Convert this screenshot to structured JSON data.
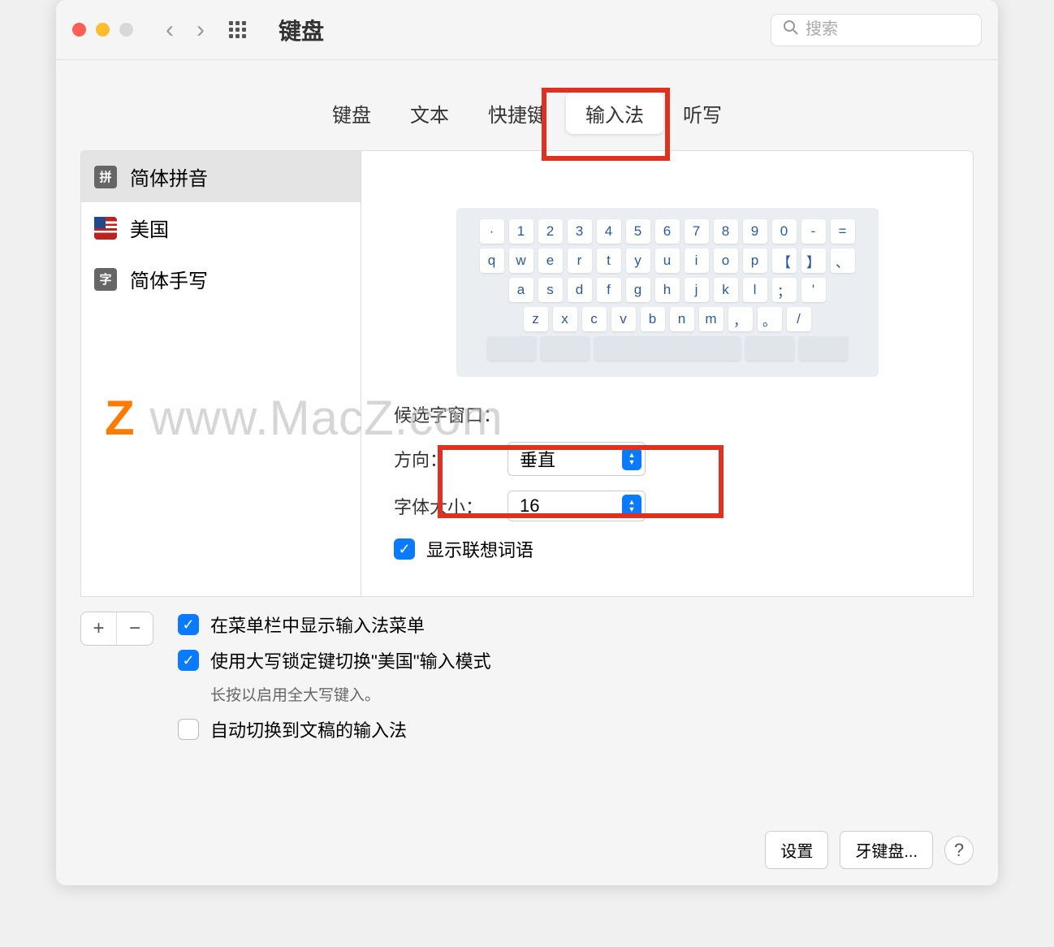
{
  "window": {
    "title": "键盘",
    "search_placeholder": "搜索"
  },
  "tabs": [
    {
      "label": "键盘"
    },
    {
      "label": "文本"
    },
    {
      "label": "快捷键"
    },
    {
      "label": "输入法",
      "active": true
    },
    {
      "label": "听写"
    }
  ],
  "input_sources": [
    {
      "badge": "拼",
      "label": "简体拼音",
      "selected": true
    },
    {
      "badge": "US",
      "label": "美国"
    },
    {
      "badge": "字",
      "label": "简体手写"
    }
  ],
  "keyboard_rows": [
    [
      "·",
      "1",
      "2",
      "3",
      "4",
      "5",
      "6",
      "7",
      "8",
      "9",
      "0",
      "-",
      "="
    ],
    [
      "q",
      "w",
      "e",
      "r",
      "t",
      "y",
      "u",
      "i",
      "o",
      "p",
      "【",
      "】",
      "、"
    ],
    [
      "a",
      "s",
      "d",
      "f",
      "g",
      "h",
      "j",
      "k",
      "l",
      "；",
      "'"
    ],
    [
      "z",
      "x",
      "c",
      "v",
      "b",
      "n",
      "m",
      "，",
      "。",
      "/"
    ]
  ],
  "candidate": {
    "section_title": "候选字窗口：",
    "direction_label": "方向：",
    "direction_value": "垂直",
    "fontsize_label": "字体大小：",
    "fontsize_value": "16",
    "show_predictions_label": "显示联想词语"
  },
  "bottom": {
    "show_menu_label": "在菜单栏中显示输入法菜单",
    "capslock_label": "使用大写锁定键切换\"美国\"输入模式",
    "capslock_hint": "长按以启用全大写键入。",
    "auto_switch_label": "自动切换到文稿的输入法"
  },
  "footer": {
    "settings": "设置",
    "bt_keyboard": "牙键盘..."
  },
  "watermark": "www.MacZ.com"
}
